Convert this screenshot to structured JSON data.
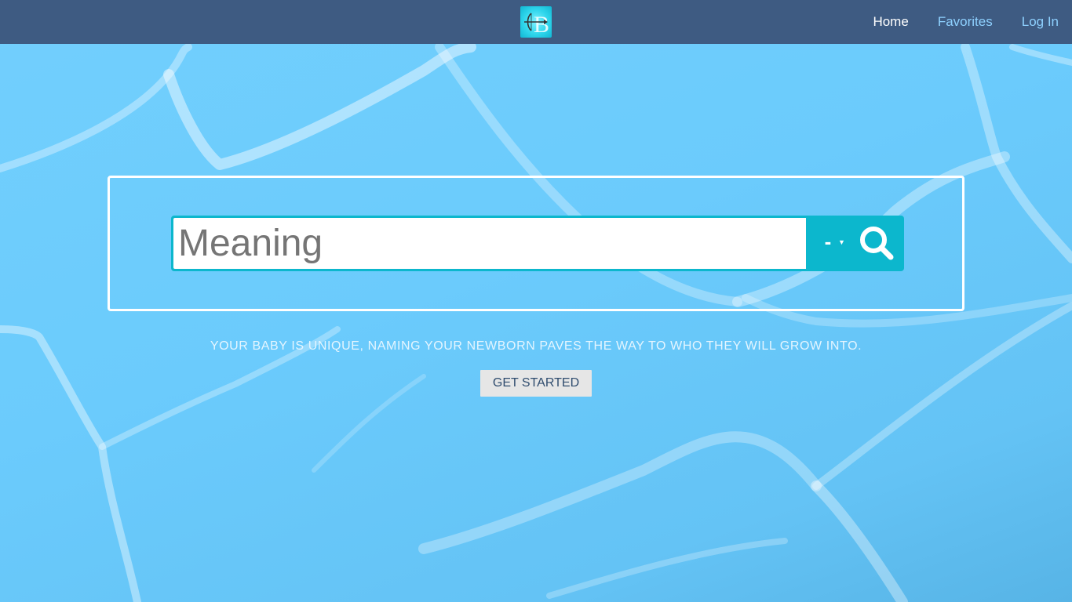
{
  "nav": {
    "logo_icon": "cupid-bow-b-logo-icon",
    "links": [
      {
        "label": "Home",
        "active": true
      },
      {
        "label": "Favorites",
        "active": false
      },
      {
        "label": "Log In",
        "active": false
      }
    ]
  },
  "search": {
    "placeholder": "Meaning",
    "select_value": "-",
    "caret_icon": "triangle-down-icon",
    "button_icon": "search-icon"
  },
  "tagline": "YOUR BABY IS UNIQUE, NAMING YOUR NEWBORN PAVES THE WAY TO WHO THEY WILL GROW INTO.",
  "cta_label": "GET STARTED",
  "colors": {
    "nav_bg": "#3e5b82",
    "accent": "#0cb7cd",
    "background": "#6ccbfb"
  }
}
